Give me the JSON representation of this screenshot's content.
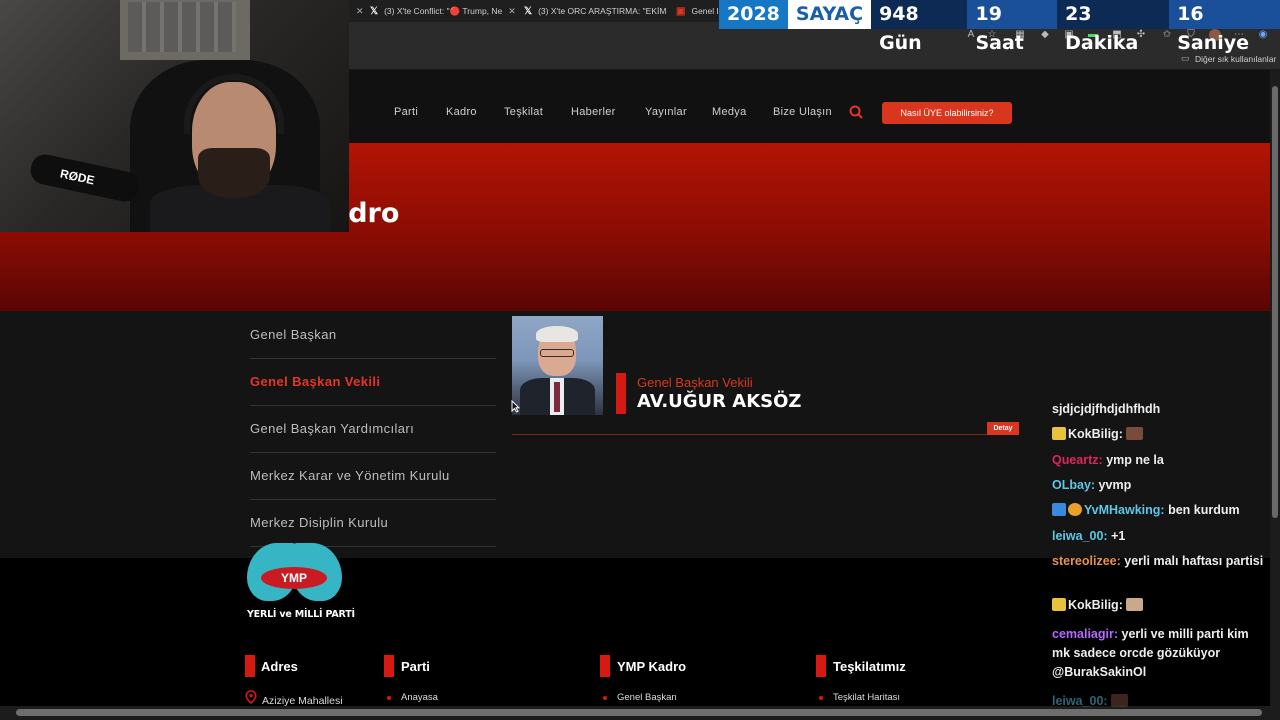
{
  "browser": {
    "tabs": [
      {
        "title": "(3) X'te Conflict: \"🔴 Trump, Ne"
      },
      {
        "title": "(3) X'te ORC ARAŞTIRMA: \"EKİM"
      },
      {
        "title": "Genel B"
      }
    ],
    "bookmarks_other": "Diğer sık kullanılanlar"
  },
  "counter": {
    "year": "2028",
    "label": "SAYAÇ",
    "days": "948 Gün",
    "hours": "19 Saat",
    "minutes": "23 Dakika",
    "seconds": "16 Saniye"
  },
  "site": {
    "nav": [
      "Parti",
      "Kadro",
      "Teşkilat",
      "Haberler",
      "Yayınlar",
      "Medya",
      "Bize Ulaşın"
    ],
    "cta": "Nasıl ÜYE olabilirsiniz?",
    "hero_title": "adro",
    "sidebar": [
      {
        "label": "Genel Başkan",
        "active": false
      },
      {
        "label": "Genel Başkan Vekili",
        "active": true
      },
      {
        "label": "Genel Başkan Yardımcıları",
        "active": false
      },
      {
        "label": "Merkez Karar ve Yönetim Kurulu",
        "active": false
      },
      {
        "label": "Merkez Disiplin Kurulu",
        "active": false
      }
    ],
    "member": {
      "role": "Genel Başkan Vekili",
      "name": "AV.UĞUR AKSÖZ",
      "detail_label": "Detay"
    },
    "footer": {
      "logo_badge": "YMP",
      "logo_text": "YERLİ ve MİLLİ PARTİ",
      "columns": [
        {
          "title": "Adres",
          "link": "Aziziye Mahallesi"
        },
        {
          "title": "Parti",
          "link": "Anayasa"
        },
        {
          "title": "YMP Kadro",
          "link": "Genel Başkan"
        },
        {
          "title": "Teşkilatımız",
          "link": "Teşkilat Haritası"
        }
      ]
    }
  },
  "webcam": {
    "mic_brand": "RØDE"
  },
  "chat": [
    {
      "user": "",
      "text": "sjdjcjdjfhdjdhfhdh",
      "color": "#eeeeee"
    },
    {
      "user": "KokBilig:",
      "text": "",
      "color": "#eeeeee"
    },
    {
      "user": "Queartz:",
      "text": "ymp ne la",
      "color": "#e0245e"
    },
    {
      "user": "OLbay:",
      "text": "yvmp",
      "color": "#5dc7e8"
    },
    {
      "user": "YvMHawking:",
      "text": "ben kurdum",
      "color": "#5dc7e8"
    },
    {
      "user": "leiwa_00:",
      "text": "+1",
      "color": "#5dc7e8"
    },
    {
      "user": "stereolizee:",
      "text": "yerli malı haftası partisi",
      "color": "#e8944a"
    },
    {
      "user": "KokBilig:",
      "text": "",
      "color": "#eeeeee"
    },
    {
      "user": "cemaliagir:",
      "text": "yerli ve milli parti kim mk sadece orcde gözüküyor @BurakSakinOl",
      "color": "#b36bff"
    },
    {
      "user": "leiwa_00:",
      "text": "",
      "color": "#5dc7e8"
    }
  ]
}
